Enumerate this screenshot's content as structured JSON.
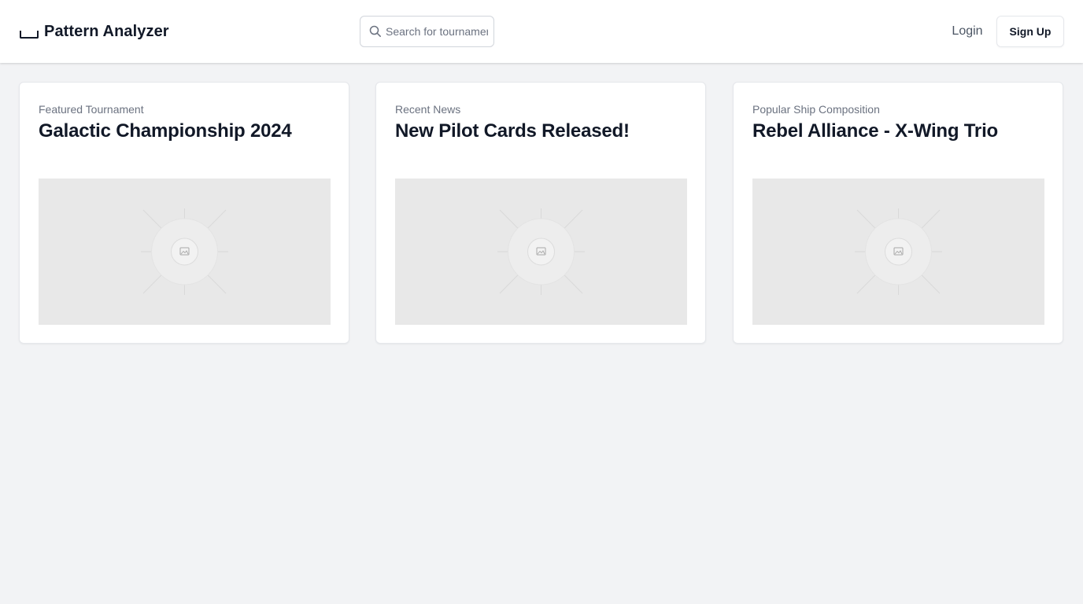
{
  "app": {
    "name": "Pattern Analyzer"
  },
  "header": {
    "search": {
      "placeholder": "Search for tournaments",
      "icon": "search-icon"
    },
    "login_label": "Login",
    "signup_label": "Sign Up"
  },
  "cards": [
    {
      "kicker": "Featured Tournament",
      "title": "Galactic Championship 2024",
      "image": "image-placeholder"
    },
    {
      "kicker": "Recent News",
      "title": "New Pilot Cards Released!",
      "image": "image-placeholder"
    },
    {
      "kicker": "Popular Ship Composition",
      "title": "Rebel Alliance - X-Wing Trio",
      "image": "image-placeholder"
    }
  ]
}
